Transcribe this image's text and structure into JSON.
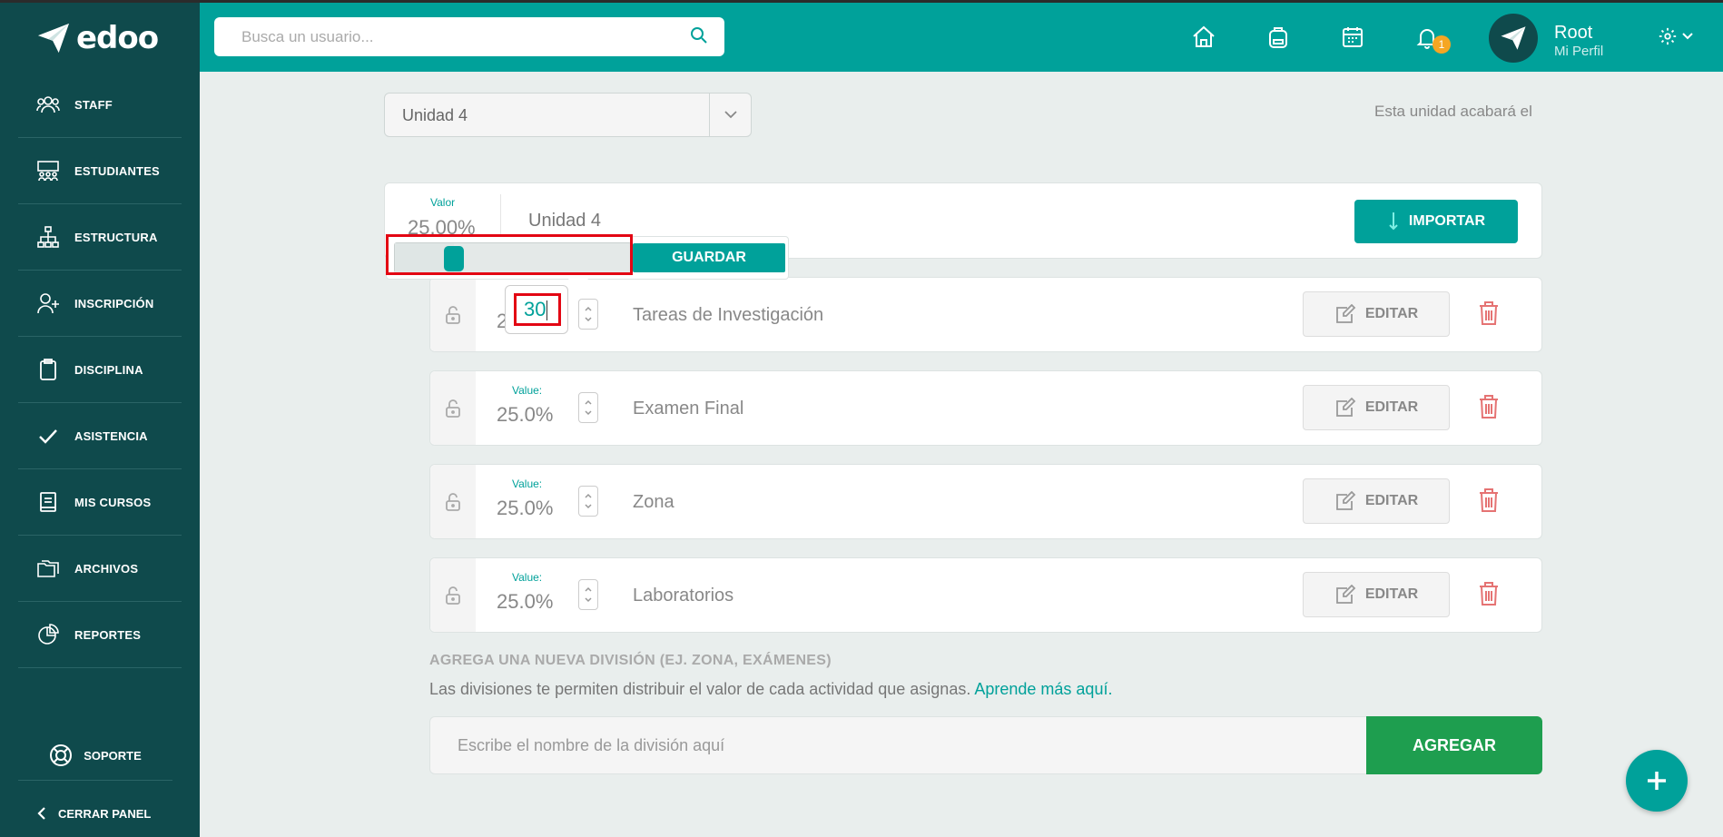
{
  "app": {
    "name": "edoo"
  },
  "sidebar": {
    "items": [
      {
        "label": "STAFF",
        "icon": "users-icon"
      },
      {
        "label": "ESTUDIANTES",
        "icon": "classroom-icon"
      },
      {
        "label": "ESTRUCTURA",
        "icon": "hierarchy-icon"
      },
      {
        "label": "INSCRIPCIÓN",
        "icon": "add-user-icon"
      },
      {
        "label": "DISCIPLINA",
        "icon": "clipboard-icon"
      },
      {
        "label": "ASISTENCIA",
        "icon": "check-icon"
      },
      {
        "label": "MIS CURSOS",
        "icon": "book-icon"
      },
      {
        "label": "ARCHIVOS",
        "icon": "folders-icon"
      },
      {
        "label": "REPORTES",
        "icon": "pie-chart-icon"
      }
    ],
    "support_label": "SOPORTE",
    "close_label": "CERRAR PANEL"
  },
  "header": {
    "search_placeholder": "Busca un usuario...",
    "notification_count": "1",
    "user_name": "Root",
    "user_profile": "Mi Perfil"
  },
  "unit_selector": {
    "selected": "Unidad 4"
  },
  "unit_end_text": "Esta unidad acabará el",
  "unit_card": {
    "value_label": "Valor",
    "value": "25.00%",
    "name": "Unidad 4",
    "import_label": "IMPORTAR"
  },
  "slider_popover": {
    "level_percent": 25,
    "save_label": "GUARDAR"
  },
  "editing_row": {
    "input_value": "30",
    "peek_digit": "2",
    "name": "Tareas de Investigación"
  },
  "divisions": [
    {
      "value_label": "Value:",
      "value": "25.0%",
      "name": "Examen Final"
    },
    {
      "value_label": "Value:",
      "value": "25.0%",
      "name": "Zona"
    },
    {
      "value_label": "Value:",
      "value": "25.0%",
      "name": "Laboratorios"
    }
  ],
  "edit_label": "EDITAR",
  "add_division": {
    "title": "AGREGA UNA NUEVA DIVISIÓN (EJ. ZONA, EXÁMENES)",
    "description": "Las divisiones te permiten distribuir el valor de cada actividad que asignas.",
    "link": "Aprende más aquí.",
    "placeholder": "Escribe el nombre de la división aquí",
    "button": "AGREGAR"
  },
  "colors": {
    "teal": "#00a19a",
    "sidebar": "#0f4a4c",
    "green": "#1e9e4f",
    "highlight": "#e30613",
    "badge": "#f5a623",
    "trash": "#e57373"
  }
}
